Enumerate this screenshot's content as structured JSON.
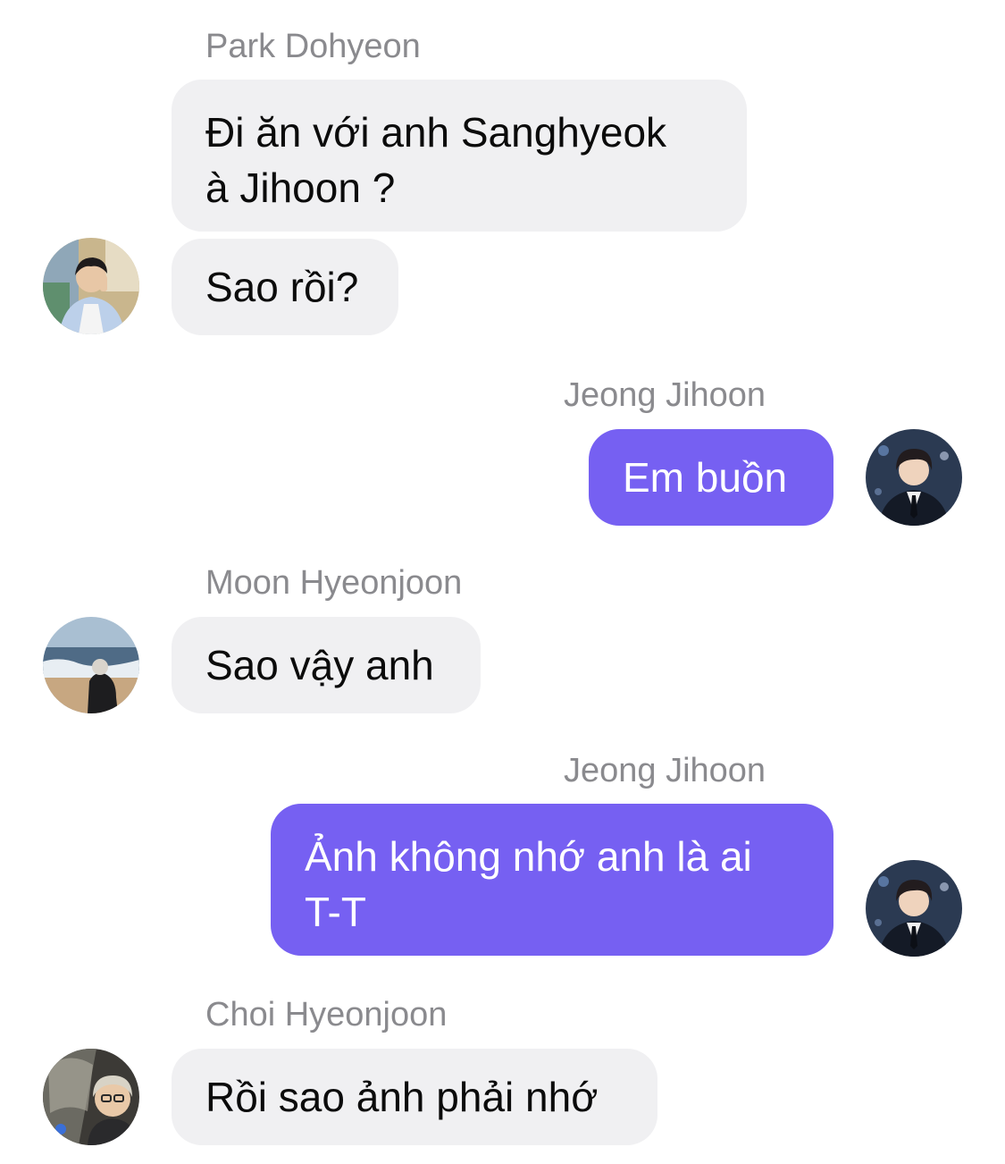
{
  "conversation": {
    "messages": [
      {
        "sender": "Park Dohyeon",
        "text": "Đi ăn với anh Sanghyeok\nà Jihoon ?"
      },
      {
        "text": "Sao rồi?"
      },
      {
        "sender": "Jeong Jihoon",
        "text": "Em buồn"
      },
      {
        "sender": "Moon Hyeonjoon",
        "text": "Sao vậy anh"
      },
      {
        "sender": "Jeong Jihoon",
        "text": "Ảnh không nhớ anh là ai\nT-T"
      },
      {
        "sender": "Choi Hyeonjoon",
        "text": "Rồi sao ảnh phải nhớ"
      }
    ]
  },
  "avatars": {
    "park": "avatar-park-dohyeon",
    "jihoon": "avatar-jeong-jihoon",
    "moon": "avatar-moon-hyeonjoon",
    "choi": "avatar-choi-hyeonjoon"
  },
  "colors": {
    "incoming_bubble": "#f0f0f2",
    "outgoing_bubble": "#7660f2",
    "sender_name": "#8a8a8e"
  }
}
